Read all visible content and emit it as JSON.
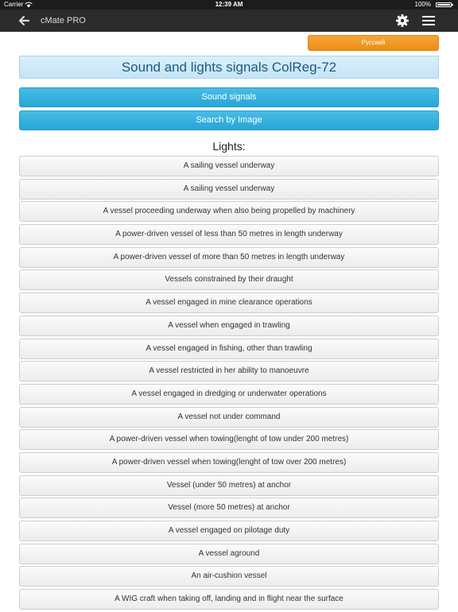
{
  "status_bar": {
    "carrier": "Carrier",
    "time": "12:39 AM",
    "battery": "100%"
  },
  "nav": {
    "title": "cMate PRO",
    "icons": {
      "back": "back-arrow-icon",
      "settings": "gear-icon",
      "menu": "hamburger-menu-icon"
    }
  },
  "language_button": "Русский",
  "header": "Sound and lights signals ColReg-72",
  "buttons": {
    "sound_signals": "Sound signals",
    "search_by_image": "Search by Image"
  },
  "lights": {
    "heading": "Lights:",
    "items": [
      "A sailing vessel underway",
      "A sailing vessel underway",
      "A vessel proceeding underway when also being propelled by machinery",
      "A power-driven vessel of less than 50 metres in length underway",
      "A power-driven vessel of more than 50 metres in length underway",
      "Vessels constrained by their draught",
      "A vessel engaged in mine clearance operations",
      "A vessel when engaged in trawling",
      "A vessel engaged in fishing, other than trawling",
      "A vessel restricted in her ability to manoeuvre",
      "A vessel engaged in dredging or underwater operations",
      "A vessel not under command",
      "A power-driven vessel when towing(lenght of tow under 200 metres)",
      "A power-driven vessel when towing(lenght of tow over 200 metres)",
      "Vessel (under 50 metres) at anchor",
      "Vessel (more 50 metres) at anchor",
      "A vessel engaged on pilotage duty",
      "A vessel aground",
      "An air-cushion vessel",
      "A WIG craft when taking off, landing and in flight near the surface"
    ]
  },
  "colors": {
    "nav_background": "#2b2b2b",
    "accent_blue": "#27a6d6",
    "accent_orange": "#ec8d15",
    "header_text": "#1d5a80"
  }
}
